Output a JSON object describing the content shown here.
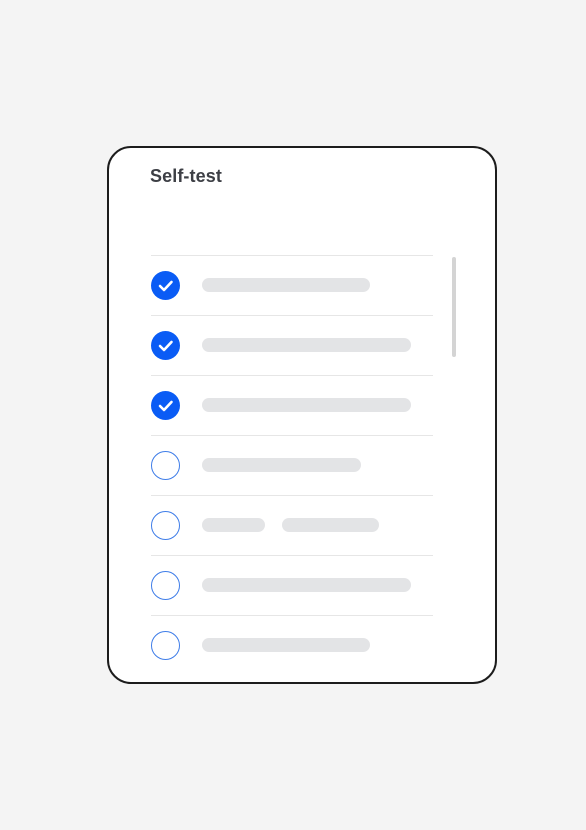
{
  "dialog": {
    "title": "Self-test"
  },
  "checklist": {
    "items": [
      {
        "checked": true
      },
      {
        "checked": true
      },
      {
        "checked": true
      },
      {
        "checked": false
      },
      {
        "checked": false
      },
      {
        "checked": false
      },
      {
        "checked": false
      }
    ]
  },
  "colors": {
    "page_background": "#f4f4f4",
    "card_background": "#ffffff",
    "card_border": "#1c1c1c",
    "checked_fill": "#0a5cf5",
    "unchecked_border": "#3f7de8",
    "placeholder_bar": "#e3e4e6",
    "title_text": "#3d3f45"
  },
  "icons": {
    "checked": "check-circle-icon",
    "unchecked": "empty-circle-icon"
  }
}
